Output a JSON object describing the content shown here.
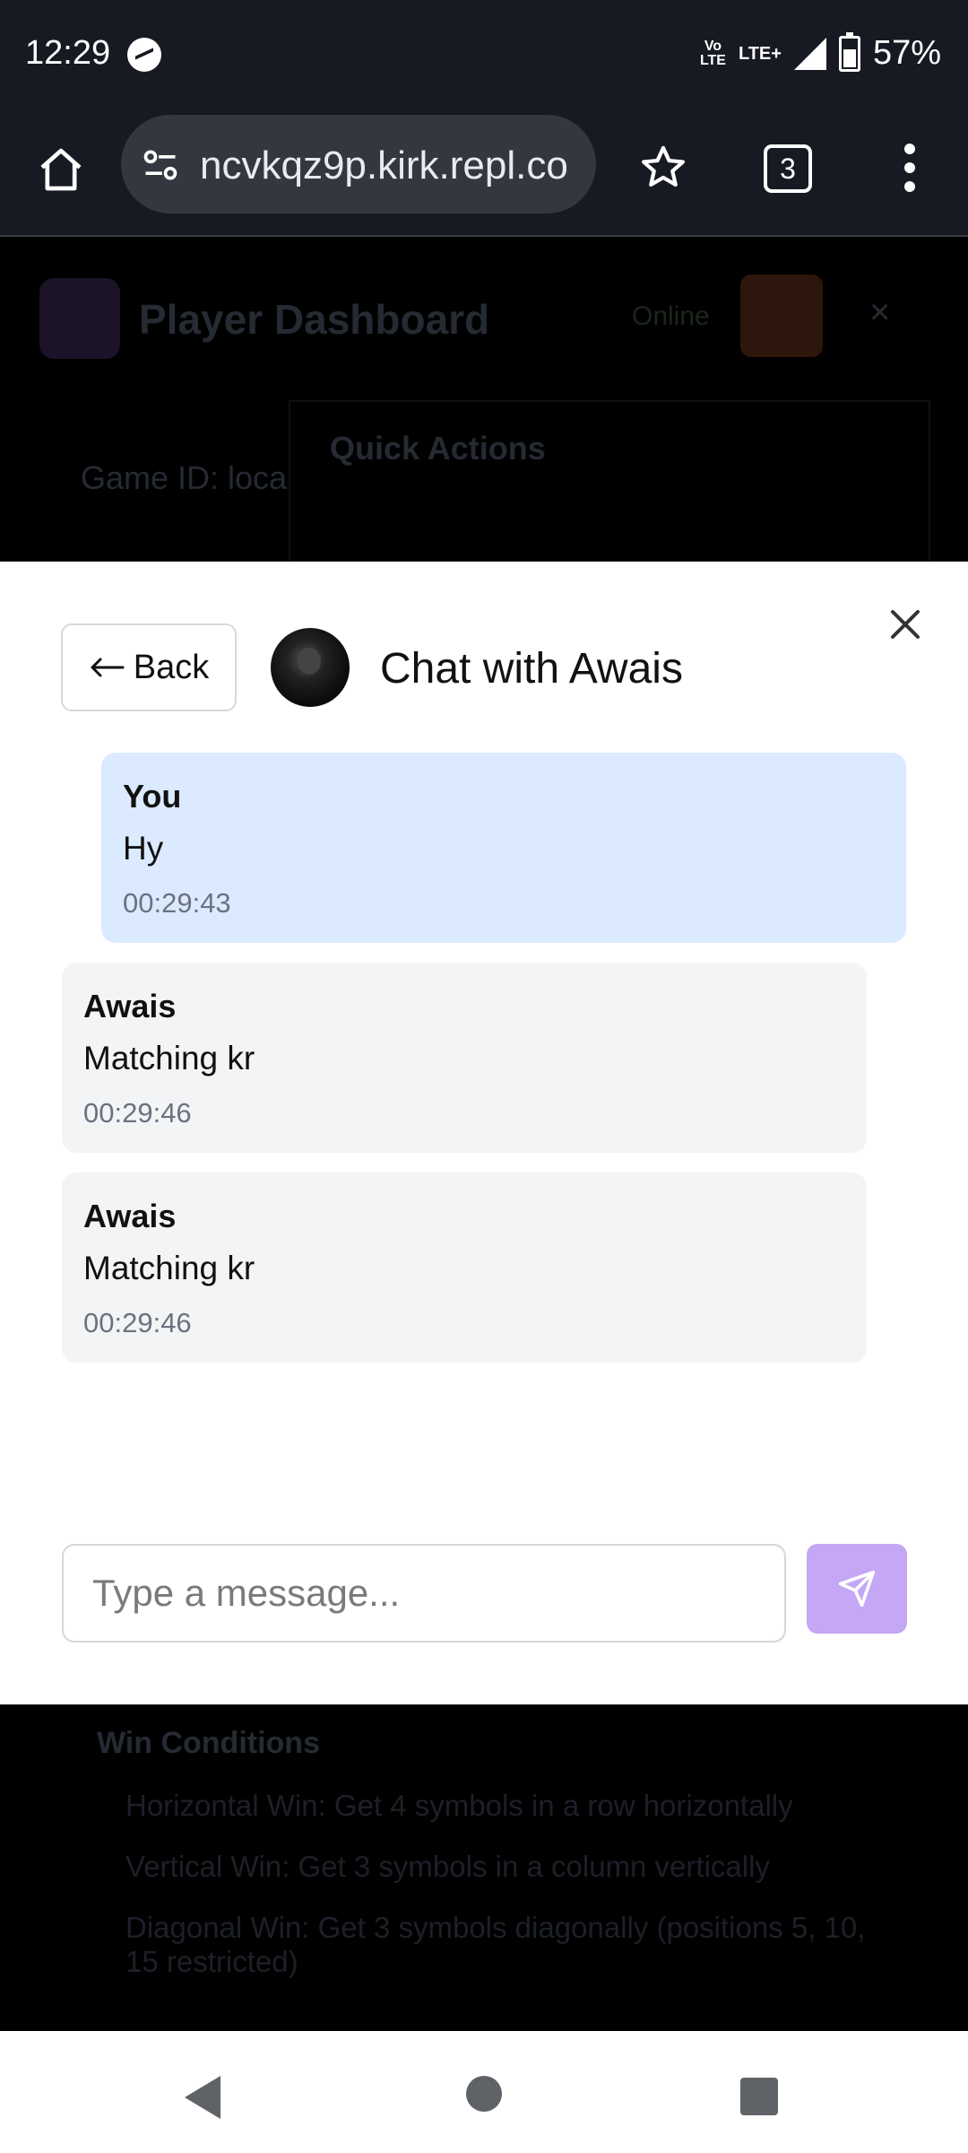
{
  "status_bar": {
    "time": "12:29",
    "volte_top": "Vo",
    "volte_bottom": "LTE",
    "network": "LTE+",
    "battery": "57%"
  },
  "browser": {
    "url": "ncvkqz9p.kirk.repl.co",
    "tab_count": "3"
  },
  "background_page": {
    "title": "Player Dashboard",
    "status": "Online",
    "quick_actions": "Quick Actions",
    "game_id": "Game ID: loca",
    "rules_heading": "Win Conditions",
    "rules": [
      "Horizontal Win: Get 4 symbols in a row horizontally",
      "Vertical Win: Get 3 symbols in a column vertically",
      "Diagonal Win: Get 3 symbols diagonally (positions 5, 10, 15 restricted)"
    ]
  },
  "chat": {
    "back_label": "Back",
    "title": "Chat with Awais",
    "messages": [
      {
        "sender": "You",
        "text": "Hy",
        "time": "00:29:43",
        "mine": true
      },
      {
        "sender": "Awais",
        "text": "Matching kr",
        "time": "00:29:46",
        "mine": false
      },
      {
        "sender": "Awais",
        "text": "Matching kr",
        "time": "00:29:46",
        "mine": false
      }
    ],
    "input_placeholder": "Type a message...",
    "send_color": "#c4a7f5"
  }
}
